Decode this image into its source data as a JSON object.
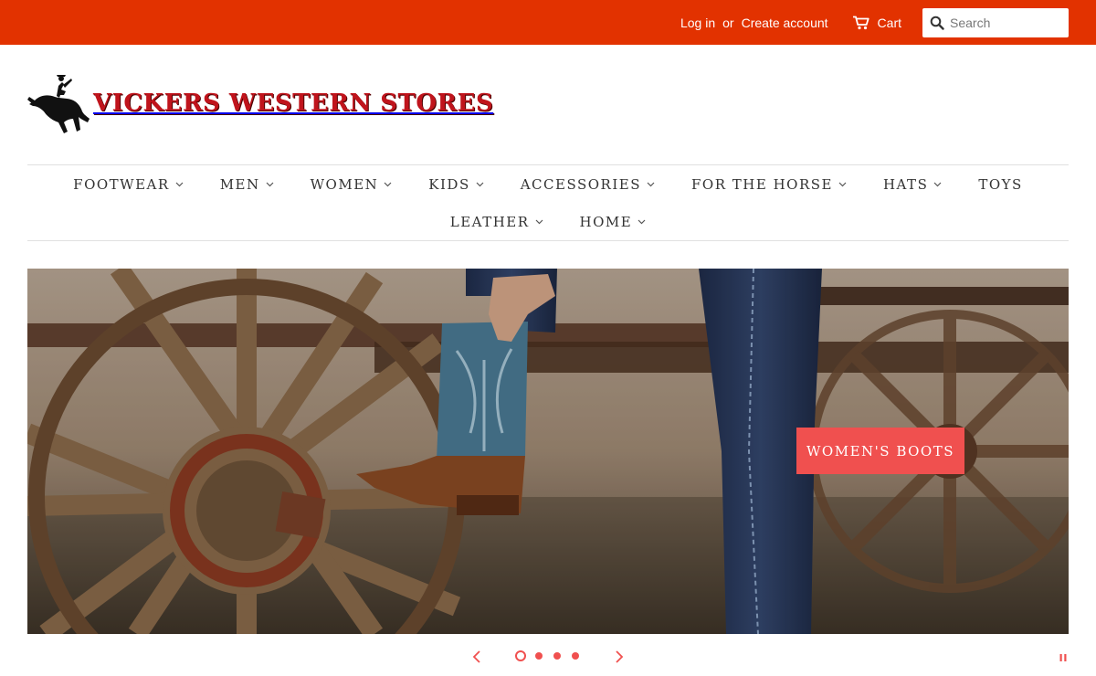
{
  "topbar": {
    "login_label": "Log in",
    "or_label": "or",
    "create_account_label": "Create account",
    "cart_label": "Cart",
    "cart_icon": "cart-icon",
    "search_icon": "search-icon",
    "search_placeholder": "Search",
    "background_color": "#e23200"
  },
  "brand": {
    "logo_text": "VICKERS WESTERN STORES",
    "logo_icon": "bucking-horse-rider-icon"
  },
  "nav": {
    "row1": [
      {
        "label": "FOOTWEAR",
        "dropdown": true
      },
      {
        "label": "MEN",
        "dropdown": true
      },
      {
        "label": "WOMEN",
        "dropdown": true
      },
      {
        "label": "KIDS",
        "dropdown": true
      },
      {
        "label": "ACCESSORIES",
        "dropdown": true
      },
      {
        "label": "FOR THE HORSE",
        "dropdown": true
      },
      {
        "label": "HATS",
        "dropdown": true
      },
      {
        "label": "TOYS",
        "dropdown": false
      }
    ],
    "row2": [
      {
        "label": "LEATHER",
        "dropdown": true
      },
      {
        "label": "HOME",
        "dropdown": true
      }
    ]
  },
  "hero": {
    "button_label": "WOMEN'S BOOTS",
    "accent_color": "#f0504f"
  },
  "slider": {
    "slide_count": 4,
    "active_index": 0,
    "prev_icon": "chevron-left-icon",
    "next_icon": "chevron-right-icon",
    "pause_icon": "pause-icon"
  }
}
